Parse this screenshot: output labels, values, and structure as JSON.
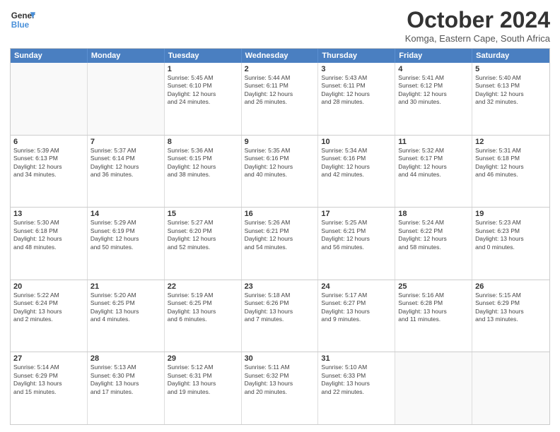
{
  "logo": {
    "line1": "General",
    "line2": "Blue"
  },
  "title": "October 2024",
  "subtitle": "Komga, Eastern Cape, South Africa",
  "header_days": [
    "Sunday",
    "Monday",
    "Tuesday",
    "Wednesday",
    "Thursday",
    "Friday",
    "Saturday"
  ],
  "weeks": [
    [
      {
        "day": "",
        "info": "",
        "empty": true
      },
      {
        "day": "",
        "info": "",
        "empty": true
      },
      {
        "day": "1",
        "info": "Sunrise: 5:45 AM\nSunset: 6:10 PM\nDaylight: 12 hours\nand 24 minutes."
      },
      {
        "day": "2",
        "info": "Sunrise: 5:44 AM\nSunset: 6:11 PM\nDaylight: 12 hours\nand 26 minutes."
      },
      {
        "day": "3",
        "info": "Sunrise: 5:43 AM\nSunset: 6:11 PM\nDaylight: 12 hours\nand 28 minutes."
      },
      {
        "day": "4",
        "info": "Sunrise: 5:41 AM\nSunset: 6:12 PM\nDaylight: 12 hours\nand 30 minutes."
      },
      {
        "day": "5",
        "info": "Sunrise: 5:40 AM\nSunset: 6:13 PM\nDaylight: 12 hours\nand 32 minutes."
      }
    ],
    [
      {
        "day": "6",
        "info": "Sunrise: 5:39 AM\nSunset: 6:13 PM\nDaylight: 12 hours\nand 34 minutes."
      },
      {
        "day": "7",
        "info": "Sunrise: 5:37 AM\nSunset: 6:14 PM\nDaylight: 12 hours\nand 36 minutes."
      },
      {
        "day": "8",
        "info": "Sunrise: 5:36 AM\nSunset: 6:15 PM\nDaylight: 12 hours\nand 38 minutes."
      },
      {
        "day": "9",
        "info": "Sunrise: 5:35 AM\nSunset: 6:16 PM\nDaylight: 12 hours\nand 40 minutes."
      },
      {
        "day": "10",
        "info": "Sunrise: 5:34 AM\nSunset: 6:16 PM\nDaylight: 12 hours\nand 42 minutes."
      },
      {
        "day": "11",
        "info": "Sunrise: 5:32 AM\nSunset: 6:17 PM\nDaylight: 12 hours\nand 44 minutes."
      },
      {
        "day": "12",
        "info": "Sunrise: 5:31 AM\nSunset: 6:18 PM\nDaylight: 12 hours\nand 46 minutes."
      }
    ],
    [
      {
        "day": "13",
        "info": "Sunrise: 5:30 AM\nSunset: 6:18 PM\nDaylight: 12 hours\nand 48 minutes."
      },
      {
        "day": "14",
        "info": "Sunrise: 5:29 AM\nSunset: 6:19 PM\nDaylight: 12 hours\nand 50 minutes."
      },
      {
        "day": "15",
        "info": "Sunrise: 5:27 AM\nSunset: 6:20 PM\nDaylight: 12 hours\nand 52 minutes."
      },
      {
        "day": "16",
        "info": "Sunrise: 5:26 AM\nSunset: 6:21 PM\nDaylight: 12 hours\nand 54 minutes."
      },
      {
        "day": "17",
        "info": "Sunrise: 5:25 AM\nSunset: 6:21 PM\nDaylight: 12 hours\nand 56 minutes."
      },
      {
        "day": "18",
        "info": "Sunrise: 5:24 AM\nSunset: 6:22 PM\nDaylight: 12 hours\nand 58 minutes."
      },
      {
        "day": "19",
        "info": "Sunrise: 5:23 AM\nSunset: 6:23 PM\nDaylight: 13 hours\nand 0 minutes."
      }
    ],
    [
      {
        "day": "20",
        "info": "Sunrise: 5:22 AM\nSunset: 6:24 PM\nDaylight: 13 hours\nand 2 minutes."
      },
      {
        "day": "21",
        "info": "Sunrise: 5:20 AM\nSunset: 6:25 PM\nDaylight: 13 hours\nand 4 minutes."
      },
      {
        "day": "22",
        "info": "Sunrise: 5:19 AM\nSunset: 6:25 PM\nDaylight: 13 hours\nand 6 minutes."
      },
      {
        "day": "23",
        "info": "Sunrise: 5:18 AM\nSunset: 6:26 PM\nDaylight: 13 hours\nand 7 minutes."
      },
      {
        "day": "24",
        "info": "Sunrise: 5:17 AM\nSunset: 6:27 PM\nDaylight: 13 hours\nand 9 minutes."
      },
      {
        "day": "25",
        "info": "Sunrise: 5:16 AM\nSunset: 6:28 PM\nDaylight: 13 hours\nand 11 minutes."
      },
      {
        "day": "26",
        "info": "Sunrise: 5:15 AM\nSunset: 6:29 PM\nDaylight: 13 hours\nand 13 minutes."
      }
    ],
    [
      {
        "day": "27",
        "info": "Sunrise: 5:14 AM\nSunset: 6:29 PM\nDaylight: 13 hours\nand 15 minutes."
      },
      {
        "day": "28",
        "info": "Sunrise: 5:13 AM\nSunset: 6:30 PM\nDaylight: 13 hours\nand 17 minutes."
      },
      {
        "day": "29",
        "info": "Sunrise: 5:12 AM\nSunset: 6:31 PM\nDaylight: 13 hours\nand 19 minutes."
      },
      {
        "day": "30",
        "info": "Sunrise: 5:11 AM\nSunset: 6:32 PM\nDaylight: 13 hours\nand 20 minutes."
      },
      {
        "day": "31",
        "info": "Sunrise: 5:10 AM\nSunset: 6:33 PM\nDaylight: 13 hours\nand 22 minutes."
      },
      {
        "day": "",
        "info": "",
        "empty": true
      },
      {
        "day": "",
        "info": "",
        "empty": true
      }
    ]
  ]
}
